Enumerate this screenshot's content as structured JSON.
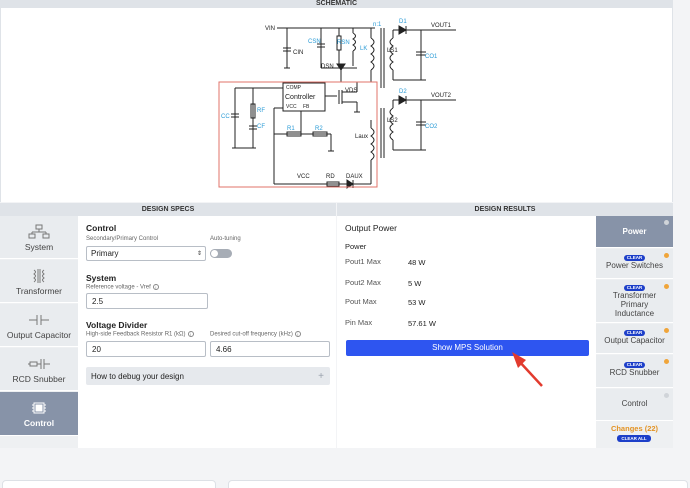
{
  "schematic": {
    "header": "SCHEMATIC",
    "labels": {
      "vin": "VIN",
      "cin": "CIN",
      "csn": "CSN",
      "rsn": "RSN",
      "lk": "LK",
      "n1": "n:1",
      "d1": "D1",
      "vout1": "VOUT1",
      "ls1": "LS1",
      "co1": "CO1",
      "dsn": "DSN",
      "comp": "COMP",
      "controller": "Controller",
      "vcc": "VCC",
      "fb": "FB",
      "vds": "VDS",
      "rf": "RF",
      "cf": "CF",
      "cc": "CC",
      "r1": "R1",
      "r2": "R2",
      "d2": "D2",
      "vout2": "VOUT2",
      "ls2": "LS2",
      "co2": "CO2",
      "laux": "Laux",
      "vcc_node": "VCC",
      "rd": "RD",
      "daux": "DAUX"
    }
  },
  "specs": {
    "header": "DESIGN SPECS",
    "control_title": "Control",
    "sec_primary_label": "Secondary/Primary Control",
    "sec_primary_value": "Primary",
    "auto_tuning_label": "Auto-tuning",
    "system_title": "System",
    "vref_label": "Reference voltage - Vref",
    "vref_value": "2.5",
    "divider_title": "Voltage Divider",
    "r1_label": "High-side Feedback Resistor R1 (kΩ)",
    "r1_value": "20",
    "cutoff_label": "Desired cut-off frequency (kHz)",
    "cutoff_value": "4.66",
    "debug_label": "How to debug your design"
  },
  "leftnav": {
    "items": [
      {
        "label": "System",
        "icon": "system-icon"
      },
      {
        "label": "Transformer",
        "icon": "transformer-icon"
      },
      {
        "label": "Output Capacitor",
        "icon": "capacitor-icon"
      },
      {
        "label": "RCD Snubber",
        "icon": "snubber-icon"
      },
      {
        "label": "Control",
        "icon": "chip-icon"
      }
    ]
  },
  "results": {
    "header": "DESIGN RESULTS",
    "title": "Output Power",
    "sub": "Power",
    "rows": [
      {
        "key": "Pout1 Max",
        "value": "48 W"
      },
      {
        "key": "Pout2 Max",
        "value": "5 W"
      },
      {
        "key": "Pout Max",
        "value": "53 W"
      },
      {
        "key": "Pin Max",
        "value": "57.61 W"
      }
    ],
    "button": "Show MPS Solution"
  },
  "rightnav": {
    "items": [
      {
        "label": "Power"
      },
      {
        "label": "Power Switches",
        "badge": "CLEAR"
      },
      {
        "label": "Transformer Primary Inductance",
        "badge": "CLEAR"
      },
      {
        "label": "Output Capacitor",
        "badge": "CLEAR"
      },
      {
        "label": "RCD Snubber",
        "badge": "CLEAR"
      },
      {
        "label": "Control"
      }
    ],
    "changes": "Changes (22)",
    "clear_all": "CLEAR ALL"
  },
  "colors": {
    "accent": "#2e55f0",
    "nav_active": "#8793a8",
    "highlight_box": "#e0736a",
    "badge": "#1d3fc9",
    "changes": "#e39324",
    "arrow": "#e23b2e"
  }
}
